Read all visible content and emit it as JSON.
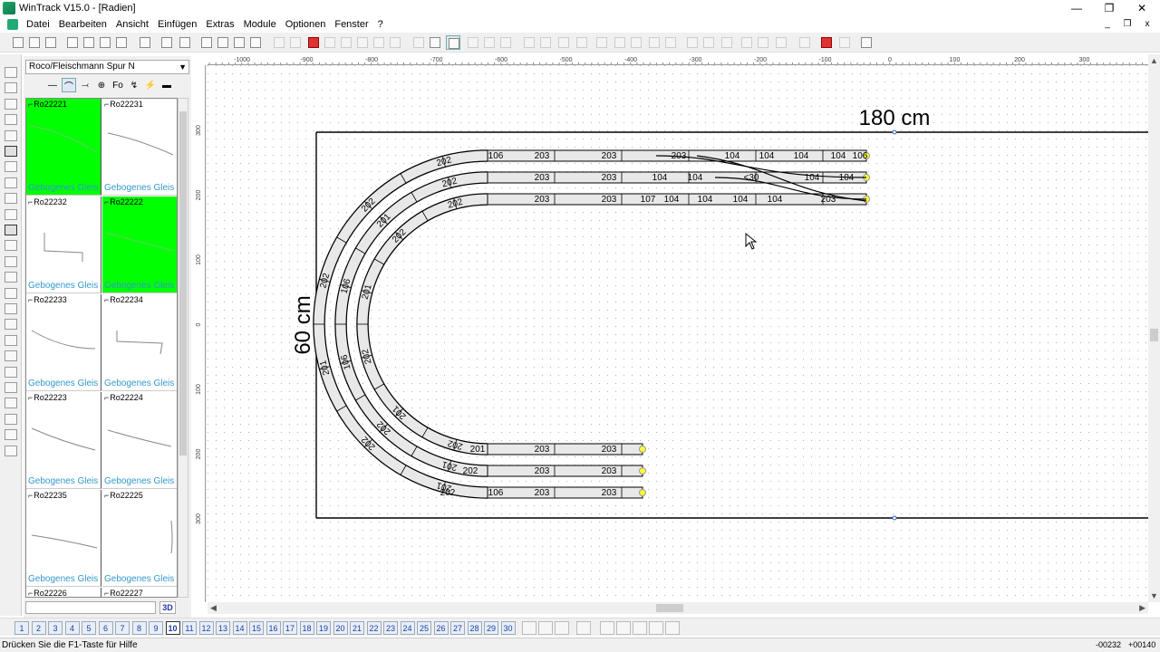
{
  "window": {
    "title": "WinTrack  V15.0 - [Radien]",
    "minimize": "—",
    "maximize": "❐",
    "close": "✕",
    "mdi_minimize": "_",
    "mdi_restore": "❐",
    "mdi_close": "x"
  },
  "menu": [
    "Datei",
    "Bearbeiten",
    "Ansicht",
    "Einfügen",
    "Extras",
    "Module",
    "Optionen",
    "Fenster",
    "?"
  ],
  "library": {
    "selected": "Roco/Fleischmann Spur N",
    "dropdown_glyph": "▼",
    "tab_icons": [
      "—",
      "⌒",
      "⤙",
      "⊕",
      "Fo",
      "↯",
      "⚡",
      "▬"
    ],
    "items": [
      {
        "code": "Ro22221",
        "name": "Gebogenes Gleis",
        "selected": true
      },
      {
        "code": "Ro22231",
        "name": "Gebogenes Gleis",
        "selected": false
      },
      {
        "code": "Ro22232",
        "name": "Gebogenes Gleis",
        "selected": false
      },
      {
        "code": "Ro22222",
        "name": "Gebogenes Gleis",
        "selected": true
      },
      {
        "code": "Ro22233",
        "name": "Gebogenes Gleis",
        "selected": false
      },
      {
        "code": "Ro22234",
        "name": "Gebogenes Gleis",
        "selected": false
      },
      {
        "code": "Ro22223",
        "name": "Gebogenes Gleis",
        "selected": false
      },
      {
        "code": "Ro22224",
        "name": "Gebogenes Gleis",
        "selected": false
      },
      {
        "code": "Ro22235",
        "name": "Gebogenes Gleis",
        "selected": false
      },
      {
        "code": "Ro22225",
        "name": "Gebogenes Gleis",
        "selected": false
      },
      {
        "code": "Ro22226",
        "name": "",
        "selected": false
      },
      {
        "code": "Ro22227",
        "name": "",
        "selected": false
      }
    ],
    "view3d": "3D"
  },
  "ruler": {
    "top_labels": [
      "-1000",
      "-900",
      "-800",
      "-700",
      "-600",
      "-500",
      "-400",
      "-300",
      "-200",
      "-100",
      "0",
      "100",
      "200",
      "300"
    ],
    "left_labels": [
      "300",
      "200",
      "100",
      "0",
      "100",
      "200",
      "300"
    ]
  },
  "layout": {
    "width_label": "180 cm",
    "height_label": "60 cm",
    "colors": {
      "track_fill": "#e8e8e8",
      "track_stroke": "#000000",
      "end_marker": "#ffff33",
      "grid": "#b0b0b0"
    },
    "labels": {
      "track1_top": [
        "106",
        "203",
        "203",
        "203",
        "104",
        "104",
        "104",
        "104",
        "106"
      ],
      "track2_top": [
        "203",
        "203",
        "104",
        "104",
        "<30",
        "104",
        "104"
      ],
      "track3_top": [
        "203",
        "203",
        "107",
        "104",
        "104",
        "104",
        "104",
        "203"
      ],
      "curves": [
        "202",
        "202",
        "202",
        "201",
        "202",
        "201",
        "202",
        "201",
        "106",
        "106",
        "202",
        "201",
        "202",
        "202",
        "201",
        "202",
        "201",
        "202"
      ],
      "bottom1": [
        "201",
        "203",
        "203"
      ],
      "bottom2": [
        "202",
        "203",
        "203"
      ],
      "bottom3": [
        "202",
        "106",
        "203",
        "203"
      ]
    }
  },
  "pages": [
    "1",
    "2",
    "3",
    "4",
    "5",
    "6",
    "7",
    "8",
    "9",
    "10",
    "11",
    "12",
    "13",
    "14",
    "15",
    "16",
    "17",
    "18",
    "19",
    "20",
    "21",
    "22",
    "23",
    "24",
    "25",
    "26",
    "27",
    "28",
    "29",
    "30"
  ],
  "active_page": "10",
  "status": {
    "hint": "Drücken Sie die  F1-Taste für Hilfe",
    "x": "-00232",
    "y": "+00140"
  }
}
